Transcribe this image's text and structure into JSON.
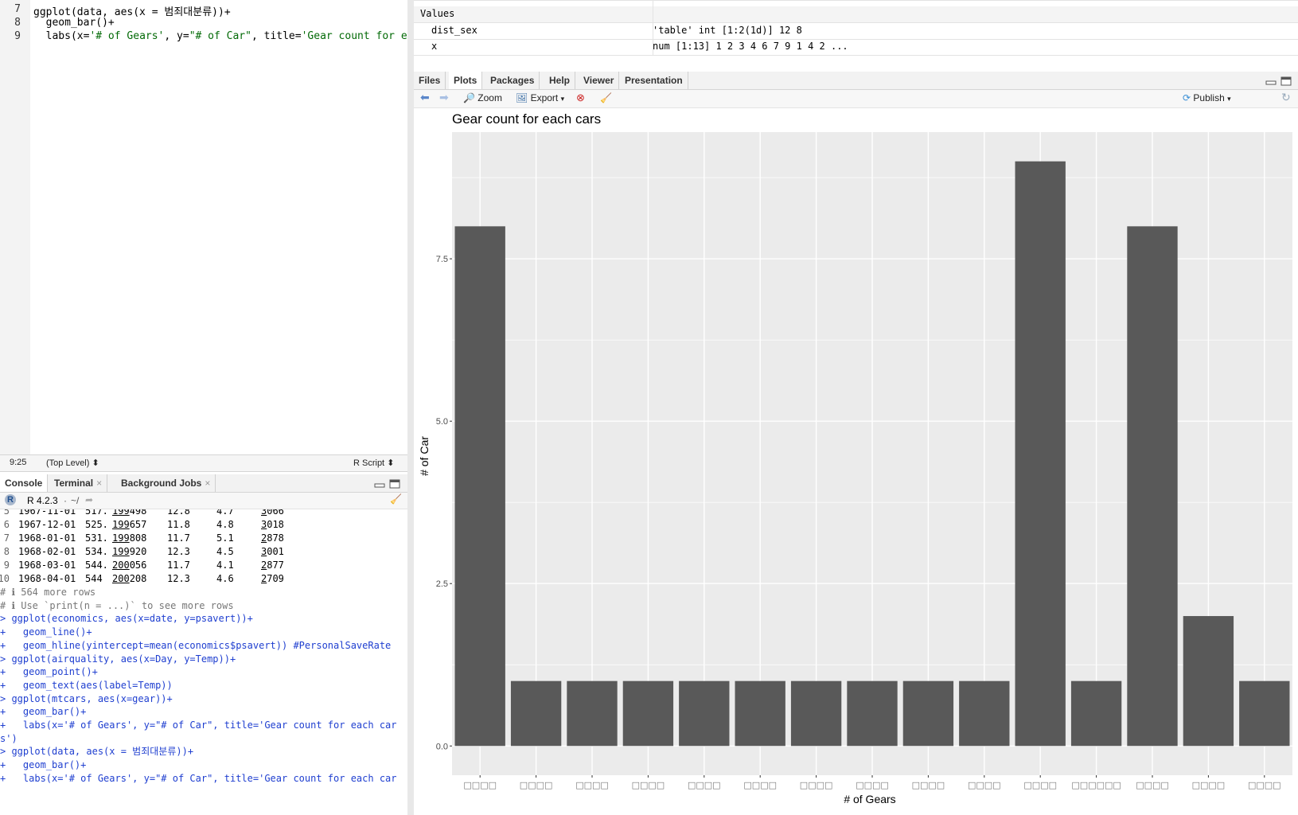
{
  "editor": {
    "lines": [
      {
        "num": "7",
        "parts": [
          {
            "t": "ggplot(data, aes(x = 범죄대분류))+",
            "c": ""
          }
        ]
      },
      {
        "num": "8",
        "parts": [
          {
            "t": "  geom_bar()+",
            "c": ""
          }
        ]
      },
      {
        "num": "9",
        "parts": [
          {
            "t": "  labs(x=",
            "c": ""
          },
          {
            "t": "'# of Gears'",
            "c": "str"
          },
          {
            "t": ", y=",
            "c": ""
          },
          {
            "t": "\"# of Car\"",
            "c": "str"
          },
          {
            "t": ", title=",
            "c": ""
          },
          {
            "t": "'Gear count for each c",
            "c": "str"
          }
        ]
      }
    ],
    "status": {
      "position": "9:25",
      "scope": "(Top Level)",
      "file_type": "R Script"
    }
  },
  "console_pane": {
    "tabs": [
      "Console",
      "Terminal",
      "Background Jobs"
    ],
    "r_version": "R 4.2.3",
    "path": "~/",
    "rows": [
      {
        "n": "5",
        "date": "1967-11-01",
        "pce": "517.",
        "pop_hi": "199",
        "pop_lo": "498",
        "psavert": "12.8",
        "uempmed": "4.7",
        "un_hi": "3",
        "un_lo": "066"
      },
      {
        "n": "6",
        "date": "1967-12-01",
        "pce": "525.",
        "pop_hi": "199",
        "pop_lo": "657",
        "psavert": "11.8",
        "uempmed": "4.8",
        "un_hi": "3",
        "un_lo": "018"
      },
      {
        "n": "7",
        "date": "1968-01-01",
        "pce": "531.",
        "pop_hi": "199",
        "pop_lo": "808",
        "psavert": "11.7",
        "uempmed": "5.1",
        "un_hi": "2",
        "un_lo": "878"
      },
      {
        "n": "8",
        "date": "1968-02-01",
        "pce": "534.",
        "pop_hi": "199",
        "pop_lo": "920",
        "psavert": "12.3",
        "uempmed": "4.5",
        "un_hi": "3",
        "un_lo": "001"
      },
      {
        "n": "9",
        "date": "1968-03-01",
        "pce": "544.",
        "pop_hi": "200",
        "pop_lo": "056",
        "psavert": "11.7",
        "uempmed": "4.1",
        "un_hi": "2",
        "un_lo": "877"
      },
      {
        "n": "10",
        "date": "1968-04-01",
        "pce": "544",
        "pop_hi": "200",
        "pop_lo": "208",
        "psavert": "12.3",
        "uempmed": "4.6",
        "un_hi": "2",
        "un_lo": "709"
      }
    ],
    "lines": [
      {
        "text": "# ℹ 564 more rows",
        "cls": "gray"
      },
      {
        "text": "# ℹ Use `print(n = ...)` to see more rows",
        "cls": "gray"
      },
      {
        "text": "> ggplot(economics, aes(x=date, y=psavert))+",
        "cls": "blue"
      },
      {
        "text": "+   geom_line()+",
        "cls": "blue"
      },
      {
        "text": "+   geom_hline(yintercept=mean(economics$psavert)) #PersonalSaveRate",
        "cls": "blue"
      },
      {
        "text": "> ggplot(airquality, aes(x=Day, y=Temp))+",
        "cls": "blue"
      },
      {
        "text": "+   geom_point()+",
        "cls": "blue"
      },
      {
        "text": "+   geom_text(aes(label=Temp))",
        "cls": "blue"
      },
      {
        "text": "> ggplot(mtcars, aes(x=gear))+",
        "cls": "blue"
      },
      {
        "text": "+   geom_bar()+",
        "cls": "blue"
      },
      {
        "text": "+   labs(x='# of Gears', y=\"# of Car\", title='Gear count for each car",
        "cls": "blue"
      },
      {
        "text": "s')",
        "cls": "blue"
      },
      {
        "text": "> ggplot(data, aes(x = 범죄대분류))+",
        "cls": "blue"
      },
      {
        "text": "+   geom_bar()+",
        "cls": "blue"
      },
      {
        "text": "+   labs(x='# of Gears', y=\"# of Car\", title='Gear count for each car",
        "cls": "blue"
      }
    ]
  },
  "environment": {
    "section": "Values",
    "rows": [
      {
        "name": "dist_sex",
        "value": "'table' int [1:2(1d)] 12 8"
      },
      {
        "name": "x",
        "value": "num [1:13] 1 2 3 4 6 7 9 1 4 2 ..."
      }
    ]
  },
  "plots_pane": {
    "tabs": [
      "Files",
      "Plots",
      "Packages",
      "Help",
      "Viewer",
      "Presentation"
    ],
    "active_tab": "Plots",
    "toolbar": {
      "zoom": "Zoom",
      "export": "Export",
      "publish": "Publish"
    }
  },
  "chart_data": {
    "type": "bar",
    "title": "Gear count for each cars",
    "xlabel": "# of Gears",
    "ylabel": "# of Car",
    "categories": [
      "□□□□",
      "□□□□",
      "□□□□",
      "□□□□",
      "□□□□",
      "□□□□",
      "□□□□",
      "□□□□",
      "□□□□",
      "□□□□",
      "□□□□",
      "□□□□□□",
      "□□□□",
      "□□□□",
      "□□□□"
    ],
    "values": [
      8,
      1,
      1,
      1,
      1,
      1,
      1,
      1,
      1,
      1,
      9,
      1,
      8,
      2,
      1
    ],
    "ylim": [
      -0.45,
      9.45
    ],
    "yticks": [
      "0.0",
      "2.5",
      "5.0",
      "7.5"
    ],
    "ytick_values": [
      0,
      2.5,
      5,
      7.5
    ],
    "grid": true,
    "colors": {
      "bar": "#595959",
      "panel": "#ebebeb",
      "grid": "#ffffff"
    }
  }
}
